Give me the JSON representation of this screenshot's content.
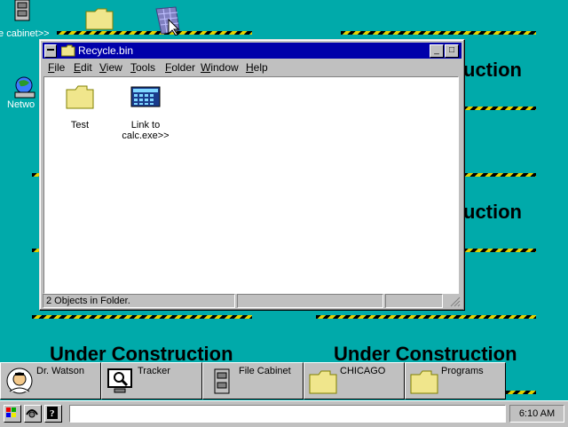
{
  "desktop": {
    "background": "#00AAAA",
    "icons": [
      {
        "label": "File cabinet>>",
        "icon": "file-cabinet-icon"
      },
      {
        "label": "",
        "icon": "folder-icon"
      },
      {
        "label": "",
        "icon": "recycle-bin-icon"
      },
      {
        "label": "Netwo",
        "icon": "network-icon"
      }
    ],
    "banners": {
      "right_1": "uction",
      "right_2": "uction",
      "bottom_left": "Under Construction",
      "bottom_right": "Under Construction"
    }
  },
  "window": {
    "title": "Recycle.bin",
    "title_color": "#0000AA",
    "controls": {
      "minimize": "_",
      "maximize": "□"
    },
    "menu": [
      {
        "label": "File",
        "underline": "F",
        "rest": "ile"
      },
      {
        "label": "Edit",
        "underline": "E",
        "rest": "dit"
      },
      {
        "label": "View",
        "underline": "V",
        "rest": "iew"
      },
      {
        "label": "Tools",
        "underline": "T",
        "rest": "ools"
      },
      {
        "label": "Folder",
        "underline": "F",
        "rest": "older"
      },
      {
        "label": "Window",
        "underline": "W",
        "rest": "indow"
      },
      {
        "label": "Help",
        "underline": "H",
        "rest": "elp"
      }
    ],
    "items": [
      {
        "label": "Test",
        "icon": "folder-icon"
      },
      {
        "label_line1": "Link to",
        "label_line2": "calc.exe>>",
        "icon": "calculator-icon"
      }
    ],
    "status": "2 Objects in Folder."
  },
  "task_tiles": [
    {
      "label": "Dr. Watson",
      "icon": "doctor-icon"
    },
    {
      "label": "Tracker",
      "icon": "monitor-magnifier-icon"
    },
    {
      "label": "File Cabinet",
      "icon": "file-cabinet-icon"
    },
    {
      "label": "CHICAGO",
      "icon": "folder-icon"
    },
    {
      "label": "Programs",
      "icon": "folder-icon"
    }
  ],
  "taskbar": {
    "command_value": "",
    "clock": "6:10 AM"
  }
}
